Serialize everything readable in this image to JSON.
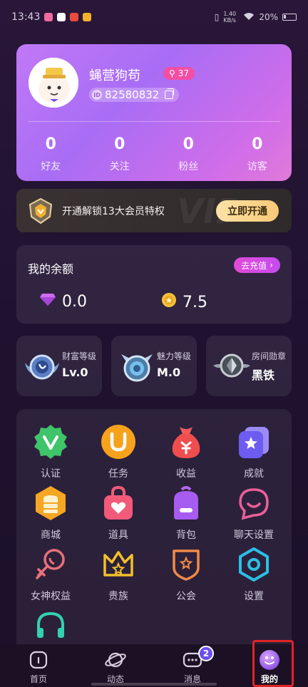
{
  "status_bar": {
    "time": "13:43",
    "net_speed": "1.40 KB/s",
    "battery": "20%"
  },
  "profile": {
    "nickname": "蝇营狗苟",
    "key_count": "37",
    "user_id": "82580832",
    "stats": [
      {
        "value": "0",
        "label": "好友"
      },
      {
        "value": "0",
        "label": "关注"
      },
      {
        "value": "0",
        "label": "粉丝"
      },
      {
        "value": "0",
        "label": "访客"
      }
    ]
  },
  "vip": {
    "text": "开通解锁13大会员特权",
    "button": "立即开通",
    "watermark": "VIP"
  },
  "balance": {
    "title": "我的余额",
    "recharge": "去充值",
    "diamonds": "0.0",
    "coins": "7.5"
  },
  "levels": [
    {
      "title": "财富等级",
      "value": "Lv.0"
    },
    {
      "title": "魅力等级",
      "value": "M.0"
    },
    {
      "title": "房间勋章",
      "value": "黑铁"
    }
  ],
  "grid": [
    {
      "label": "认证",
      "icon": "verify-icon"
    },
    {
      "label": "任务",
      "icon": "task-icon"
    },
    {
      "label": "收益",
      "icon": "money-bag-icon"
    },
    {
      "label": "成就",
      "icon": "achievement-icon"
    },
    {
      "label": "商城",
      "icon": "mall-icon"
    },
    {
      "label": "道具",
      "icon": "props-icon"
    },
    {
      "label": "背包",
      "icon": "backpack-icon"
    },
    {
      "label": "聊天设置",
      "icon": "chat-settings-icon"
    },
    {
      "label": "女神权益",
      "icon": "goddess-icon"
    },
    {
      "label": "贵族",
      "icon": "crown-icon"
    },
    {
      "label": "公会",
      "icon": "guild-icon"
    },
    {
      "label": "设置",
      "icon": "settings-icon"
    },
    {
      "label": "",
      "icon": "customer-service-icon"
    }
  ],
  "nav": [
    {
      "label": "首页"
    },
    {
      "label": "动态"
    },
    {
      "label": "消息",
      "badge": "2"
    },
    {
      "label": "我的"
    }
  ]
}
